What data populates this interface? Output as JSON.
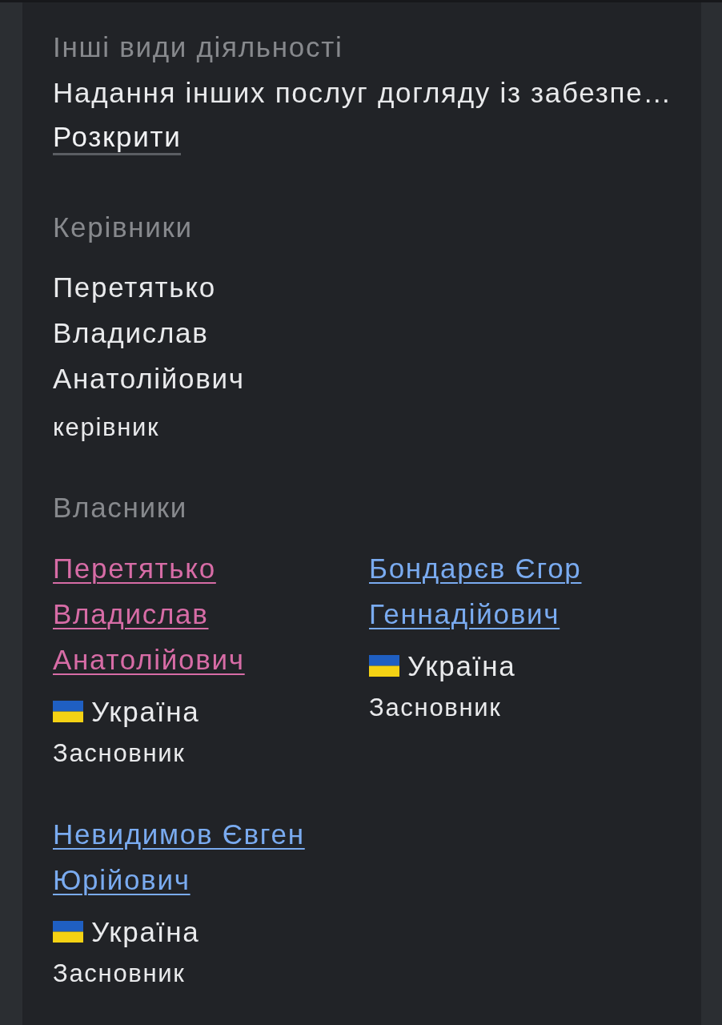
{
  "other_activities": {
    "title": "Інші види діяльності",
    "text": "Надання інших послуг догляду із забезпе…",
    "expand_link": "Розкрити"
  },
  "managers": {
    "title": "Керівники",
    "items": [
      {
        "name": "Перетятько Владислав Анатолійович",
        "role": "керівник"
      }
    ]
  },
  "owners": {
    "title": "Власники",
    "items": [
      {
        "name": "Перетятько Владислав Анатолійович",
        "color": "#d76ca6",
        "country": "Україна",
        "role": "Засновник"
      },
      {
        "name": "Бондарєв Єгор Геннадійович",
        "color": "#7aabf0",
        "country": "Україна",
        "role": "Засновник"
      },
      {
        "name": "Невидимов Євген Юрійович",
        "color": "#7aabf0",
        "country": "Україна",
        "role": "Засновник"
      }
    ]
  }
}
